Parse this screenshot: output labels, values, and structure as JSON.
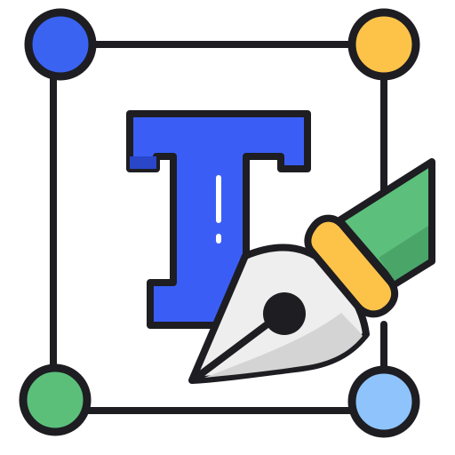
{
  "icon": {
    "name": "type-design-pen-tool-icon",
    "colors": {
      "outline": "#1d1d22",
      "letter_fill": "#3a5ef5",
      "letter_shadow": "#2a46c9",
      "node_top_left": "#3a63f2",
      "node_top_right": "#fdc349",
      "node_bottom_left": "#5bbf7a",
      "node_bottom_right": "#8ec3fb",
      "pen_body": "#eeeeee",
      "pen_body_shadow": "#d4d4d4",
      "pen_band": "#fdc349",
      "pen_cap": "#5cbf7b",
      "pen_cap_shadow": "#4aa568",
      "highlight": "#ffffff"
    }
  }
}
